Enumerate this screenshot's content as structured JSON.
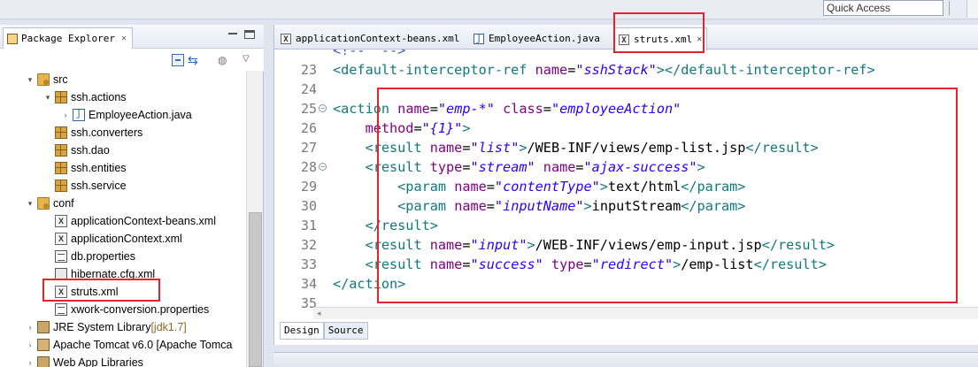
{
  "toolbar": {
    "quick_access_label": "Quick Access"
  },
  "package_explorer": {
    "tab_label": "Package Explorer",
    "tree": [
      {
        "label": "src",
        "icon": "source-folder-icon",
        "twisty": "▾",
        "depth": 1
      },
      {
        "label": "ssh.actions",
        "icon": "package-icon",
        "twisty": "▾",
        "depth": 2
      },
      {
        "label": "EmployeeAction.java",
        "icon": "java-file-icon",
        "twisty": "›",
        "depth": 3
      },
      {
        "label": "ssh.converters",
        "icon": "package-icon",
        "twisty": "",
        "depth": 2
      },
      {
        "label": "ssh.dao",
        "icon": "package-icon",
        "twisty": "",
        "depth": 2
      },
      {
        "label": "ssh.entities",
        "icon": "package-icon",
        "twisty": "",
        "depth": 2
      },
      {
        "label": "ssh.service",
        "icon": "package-icon",
        "twisty": "",
        "depth": 2
      },
      {
        "label": "conf",
        "icon": "source-folder-icon",
        "twisty": "▾",
        "depth": 1
      },
      {
        "label": "applicationContext-beans.xml",
        "icon": "xml-file-icon",
        "twisty": "",
        "depth": 2
      },
      {
        "label": "applicationContext.xml",
        "icon": "xml-file-icon",
        "twisty": "",
        "depth": 2
      },
      {
        "label": "db.properties",
        "icon": "properties-file-icon",
        "twisty": "",
        "depth": 2
      },
      {
        "label": "hibernate.cfg.xml",
        "icon": "hibernate-file-icon",
        "twisty": "",
        "depth": 2
      },
      {
        "label": "struts.xml",
        "icon": "xml-file-icon",
        "twisty": "",
        "depth": 2
      },
      {
        "label": "xwork-conversion.properties",
        "icon": "properties-file-icon",
        "twisty": "",
        "depth": 2
      },
      {
        "label": "JRE System Library",
        "suffix": "[jdk1.7]",
        "icon": "library-icon",
        "twisty": "›",
        "depth": 1
      },
      {
        "label": "Apache Tomcat v6.0 [Apache Tomca",
        "icon": "tomcat-icon",
        "twisty": "›",
        "depth": 1
      },
      {
        "label": "Web App Libraries",
        "icon": "library-icon",
        "twisty": "›",
        "depth": 1
      }
    ]
  },
  "editor": {
    "tabs": [
      {
        "label": "applicationContext-beans.xml",
        "icon": "xml-file-icon",
        "active": false
      },
      {
        "label": "EmployeeAction.java",
        "icon": "java-file-icon",
        "active": false
      },
      {
        "label": "struts.xml",
        "icon": "xml-file-icon",
        "active": true,
        "close": "✕"
      }
    ],
    "line_numbers": [
      "23",
      "24",
      "25",
      "26",
      "27",
      "28",
      "29",
      "30",
      "31",
      "32",
      "33",
      "34",
      "35"
    ],
    "fold_markers": [
      "25",
      "28"
    ],
    "bottom_tabs": [
      "Design",
      "Source"
    ]
  },
  "colors": {
    "highlight": "#e3242b",
    "tag": "#13787c",
    "attr": "#7f007f",
    "value": "#2a00ff"
  }
}
